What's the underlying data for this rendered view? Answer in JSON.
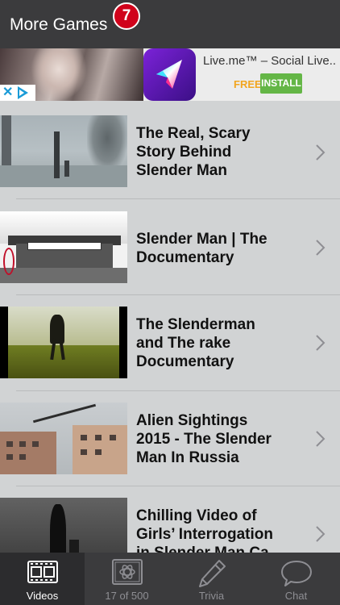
{
  "header": {
    "more_games_label": "More Games",
    "badge_count": "7"
  },
  "ad": {
    "app_title": "Live.me™ – Social Live...",
    "price": "FREE",
    "install_label": "INSTALL",
    "brand_colors": {
      "install": "#64b646",
      "free": "#f2a51f",
      "icon": "#7b22d8",
      "adchoices": "#1a9bd7"
    }
  },
  "videos": [
    {
      "title_lines": [
        "The Real, Scary",
        "Story Behind",
        "Slender Man"
      ]
    },
    {
      "title_lines": [
        "Slender Man | The",
        "Documentary"
      ]
    },
    {
      "title_lines": [
        "The Slenderman",
        "and The rake",
        "Documentary"
      ]
    },
    {
      "title_lines": [
        "Alien Sightings",
        "2015 - The Slender",
        "Man In Russia"
      ]
    },
    {
      "title_lines": [
        "Chilling Video of",
        "Girls’ Interrogation",
        "in Slender Man Ca..."
      ]
    }
  ],
  "tabs": [
    {
      "label": "Videos",
      "icon": "film-icon",
      "active": true
    },
    {
      "label": "17 of 500",
      "icon": "atom-icon",
      "active": false
    },
    {
      "label": "Trivia",
      "icon": "pencil-icon",
      "active": false
    },
    {
      "label": "Chat",
      "icon": "chat-bubble-icon",
      "active": false
    }
  ],
  "colors": {
    "header_bg": "#3b3b3d",
    "list_bg": "#d1d3d4",
    "badge_bg": "#d0021b"
  }
}
